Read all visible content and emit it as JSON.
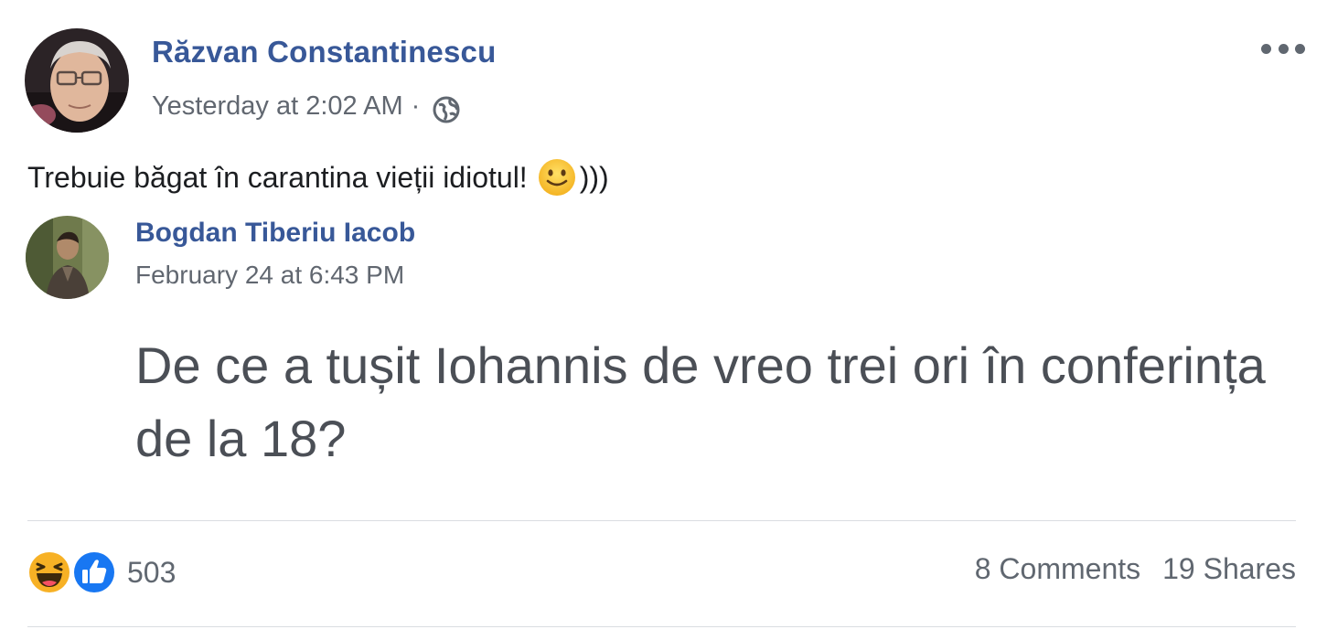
{
  "post": {
    "author": "Răzvan Constantinescu",
    "timestamp": "Yesterday at 2:02 AM",
    "separator": "·",
    "privacy_icon": "globe-icon",
    "text_before_emoji": "Trebuie băgat în carantina vieții idiotul!",
    "emoji": "slightly-smiling-face",
    "text_after_emoji": ")))",
    "menu_icon": "more-options-icon"
  },
  "shared_post": {
    "author": "Bogdan Tiberiu Iacob",
    "timestamp": "February 24 at 6:43 PM",
    "text": "De ce a tușit Iohannis de vreo trei ori în conferința de la 18?"
  },
  "footer": {
    "reaction_icons": [
      "haha-icon",
      "like-icon"
    ],
    "reaction_count": "503",
    "comments": "8 Comments",
    "shares": "19 Shares"
  },
  "colors": {
    "link": "#385898",
    "secondary_text": "#616770",
    "like_blue": "#1877f2",
    "haha_yellow": "#f7b125"
  }
}
